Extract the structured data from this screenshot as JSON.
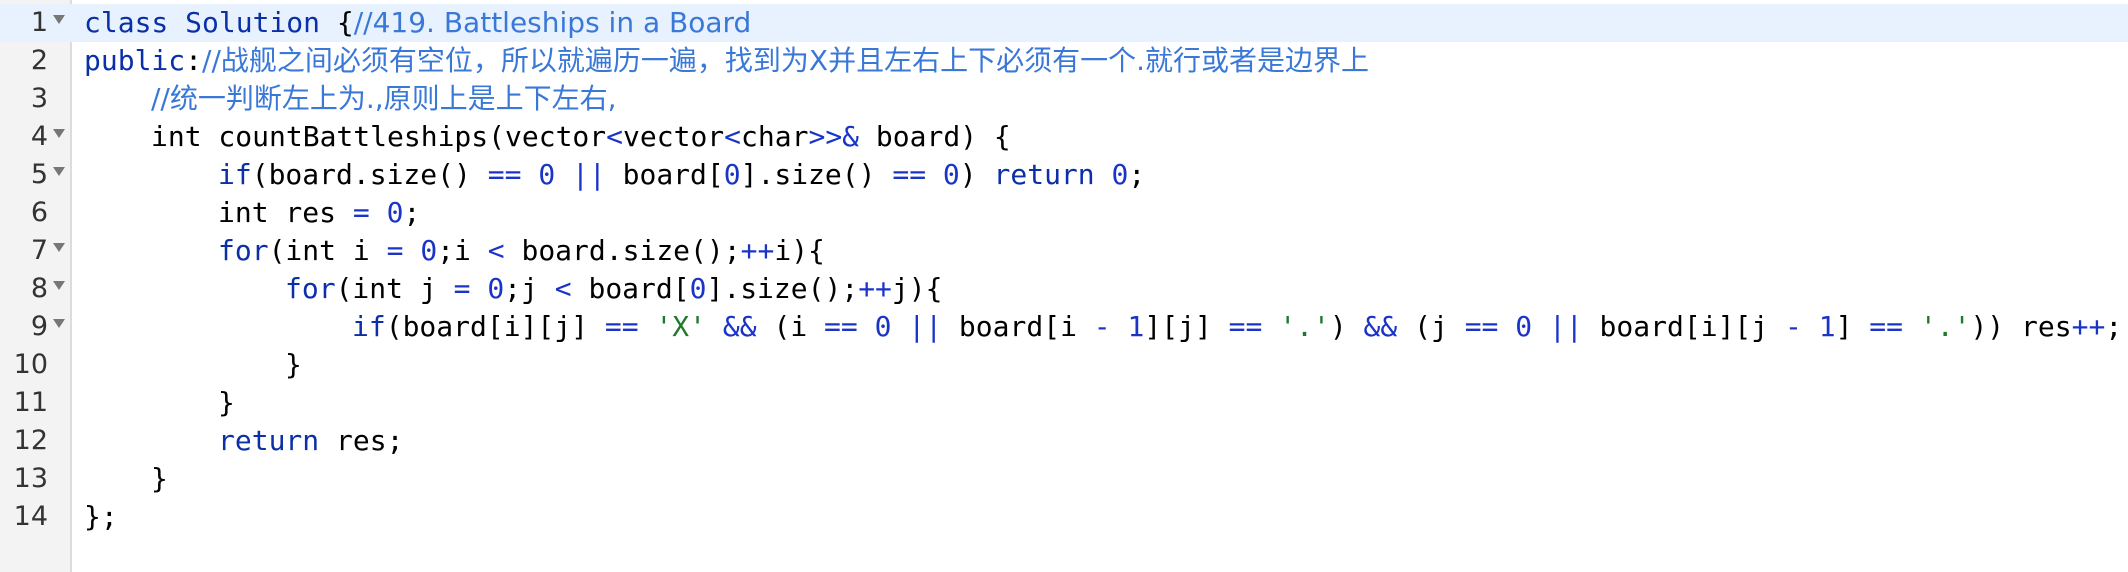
{
  "editor": {
    "lines": [
      {
        "number": "1",
        "foldable": true,
        "active": true,
        "indent": 0,
        "tokens": [
          {
            "t": "kw",
            "v": "class"
          },
          {
            "t": "pl",
            "v": " "
          },
          {
            "t": "kw",
            "v": "Solution"
          },
          {
            "t": "pl",
            "v": " {"
          },
          {
            "t": "cm",
            "v": "//419. Battleships in a Board"
          }
        ]
      },
      {
        "number": "2",
        "foldable": false,
        "active": false,
        "indent": 0,
        "tokens": [
          {
            "t": "kw",
            "v": "public"
          },
          {
            "t": "pl",
            "v": ":"
          },
          {
            "t": "cm",
            "v": "//战舰之间必须有空位，所以就遍历一遍，找到为X并且左右上下必须有一个.就行或者是边界上"
          }
        ]
      },
      {
        "number": "3",
        "foldable": false,
        "active": false,
        "indent": 1,
        "tokens": [
          {
            "t": "cm",
            "v": "//统一判断左上为.,原则上是上下左右,"
          }
        ]
      },
      {
        "number": "4",
        "foldable": true,
        "active": false,
        "indent": 1,
        "tokens": [
          {
            "t": "pl",
            "v": "int countBattleships(vector"
          },
          {
            "t": "op",
            "v": "<"
          },
          {
            "t": "pl",
            "v": "vector"
          },
          {
            "t": "op",
            "v": "<"
          },
          {
            "t": "pl",
            "v": "char"
          },
          {
            "t": "op",
            "v": ">>&"
          },
          {
            "t": "pl",
            "v": " board) {"
          }
        ]
      },
      {
        "number": "5",
        "foldable": true,
        "active": false,
        "indent": 2,
        "tokens": [
          {
            "t": "kw",
            "v": "if"
          },
          {
            "t": "pl",
            "v": "(board.size() "
          },
          {
            "t": "op",
            "v": "=="
          },
          {
            "t": "pl",
            "v": " "
          },
          {
            "t": "num",
            "v": "0"
          },
          {
            "t": "pl",
            "v": " "
          },
          {
            "t": "op",
            "v": "||"
          },
          {
            "t": "pl",
            "v": " board["
          },
          {
            "t": "num",
            "v": "0"
          },
          {
            "t": "pl",
            "v": "].size() "
          },
          {
            "t": "op",
            "v": "=="
          },
          {
            "t": "pl",
            "v": " "
          },
          {
            "t": "num",
            "v": "0"
          },
          {
            "t": "pl",
            "v": ") "
          },
          {
            "t": "kw",
            "v": "return"
          },
          {
            "t": "pl",
            "v": " "
          },
          {
            "t": "num",
            "v": "0"
          },
          {
            "t": "pl",
            "v": ";"
          }
        ]
      },
      {
        "number": "6",
        "foldable": false,
        "active": false,
        "indent": 2,
        "tokens": [
          {
            "t": "pl",
            "v": "int res "
          },
          {
            "t": "op",
            "v": "="
          },
          {
            "t": "pl",
            "v": " "
          },
          {
            "t": "num",
            "v": "0"
          },
          {
            "t": "pl",
            "v": ";"
          }
        ]
      },
      {
        "number": "7",
        "foldable": true,
        "active": false,
        "indent": 2,
        "tokens": [
          {
            "t": "kw",
            "v": "for"
          },
          {
            "t": "pl",
            "v": "(int i "
          },
          {
            "t": "op",
            "v": "="
          },
          {
            "t": "pl",
            "v": " "
          },
          {
            "t": "num",
            "v": "0"
          },
          {
            "t": "pl",
            "v": ";i "
          },
          {
            "t": "op",
            "v": "<"
          },
          {
            "t": "pl",
            "v": " board.size();"
          },
          {
            "t": "op",
            "v": "++"
          },
          {
            "t": "pl",
            "v": "i){"
          }
        ]
      },
      {
        "number": "8",
        "foldable": true,
        "active": false,
        "indent": 3,
        "tokens": [
          {
            "t": "kw",
            "v": "for"
          },
          {
            "t": "pl",
            "v": "(int j "
          },
          {
            "t": "op",
            "v": "="
          },
          {
            "t": "pl",
            "v": " "
          },
          {
            "t": "num",
            "v": "0"
          },
          {
            "t": "pl",
            "v": ";j "
          },
          {
            "t": "op",
            "v": "<"
          },
          {
            "t": "pl",
            "v": " board["
          },
          {
            "t": "num",
            "v": "0"
          },
          {
            "t": "pl",
            "v": "].size();"
          },
          {
            "t": "op",
            "v": "++"
          },
          {
            "t": "pl",
            "v": "j){"
          }
        ]
      },
      {
        "number": "9",
        "foldable": true,
        "active": false,
        "indent": 4,
        "tokens": [
          {
            "t": "kw",
            "v": "if"
          },
          {
            "t": "pl",
            "v": "(board[i][j] "
          },
          {
            "t": "op",
            "v": "=="
          },
          {
            "t": "pl",
            "v": " "
          },
          {
            "t": "str",
            "v": "'X'"
          },
          {
            "t": "pl",
            "v": " "
          },
          {
            "t": "op",
            "v": "&&"
          },
          {
            "t": "pl",
            "v": " (i "
          },
          {
            "t": "op",
            "v": "=="
          },
          {
            "t": "pl",
            "v": " "
          },
          {
            "t": "num",
            "v": "0"
          },
          {
            "t": "pl",
            "v": " "
          },
          {
            "t": "op",
            "v": "||"
          },
          {
            "t": "pl",
            "v": " board[i "
          },
          {
            "t": "op",
            "v": "-"
          },
          {
            "t": "pl",
            "v": " "
          },
          {
            "t": "num",
            "v": "1"
          },
          {
            "t": "pl",
            "v": "][j] "
          },
          {
            "t": "op",
            "v": "=="
          },
          {
            "t": "pl",
            "v": " "
          },
          {
            "t": "str",
            "v": "'.'"
          },
          {
            "t": "pl",
            "v": ") "
          },
          {
            "t": "op",
            "v": "&&"
          },
          {
            "t": "pl",
            "v": " (j "
          },
          {
            "t": "op",
            "v": "=="
          },
          {
            "t": "pl",
            "v": " "
          },
          {
            "t": "num",
            "v": "0"
          },
          {
            "t": "pl",
            "v": " "
          },
          {
            "t": "op",
            "v": "||"
          },
          {
            "t": "pl",
            "v": " board[i][j "
          },
          {
            "t": "op",
            "v": "-"
          },
          {
            "t": "pl",
            "v": " "
          },
          {
            "t": "num",
            "v": "1"
          },
          {
            "t": "pl",
            "v": "] "
          },
          {
            "t": "op",
            "v": "=="
          },
          {
            "t": "pl",
            "v": " "
          },
          {
            "t": "str",
            "v": "'.'"
          },
          {
            "t": "pl",
            "v": ")) res"
          },
          {
            "t": "op",
            "v": "++"
          },
          {
            "t": "pl",
            "v": ";"
          }
        ]
      },
      {
        "number": "10",
        "foldable": false,
        "active": false,
        "indent": 3,
        "tokens": [
          {
            "t": "pl",
            "v": "}"
          }
        ]
      },
      {
        "number": "11",
        "foldable": false,
        "active": false,
        "indent": 2,
        "tokens": [
          {
            "t": "pl",
            "v": "}"
          }
        ]
      },
      {
        "number": "12",
        "foldable": false,
        "active": false,
        "indent": 2,
        "tokens": [
          {
            "t": "kw",
            "v": "return"
          },
          {
            "t": "pl",
            "v": " res;"
          }
        ]
      },
      {
        "number": "13",
        "foldable": false,
        "active": false,
        "indent": 1,
        "tokens": [
          {
            "t": "pl",
            "v": "}"
          }
        ]
      },
      {
        "number": "14",
        "foldable": false,
        "active": false,
        "indent": 0,
        "tokens": [
          {
            "t": "pl",
            "v": "};"
          }
        ]
      }
    ]
  }
}
